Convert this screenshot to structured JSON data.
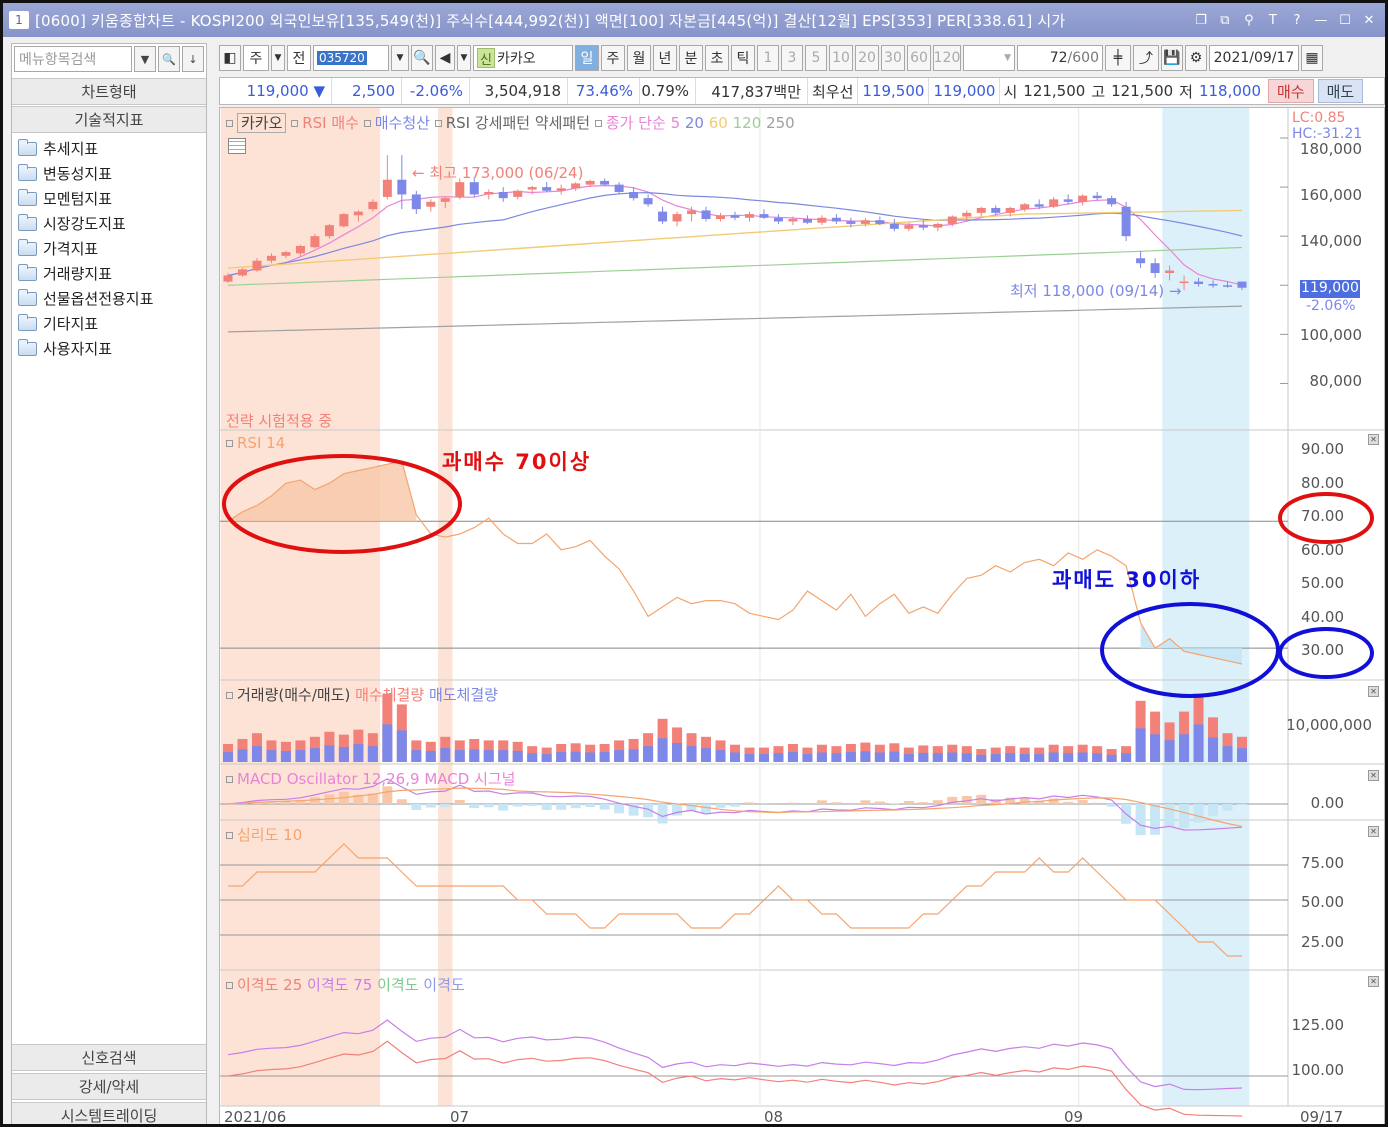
{
  "window": {
    "number": "1",
    "title": "[0600] 키움종합차트 - KOSPI200 외국인보유[135,549(천)] 주식수[444,992(천)] 액면[100] 자본금[445(억)] 결산[12월] EPS[353] PER[338.61] 시가"
  },
  "sidebar": {
    "search_placeholder": "메뉴항목검색",
    "header_top": "차트형태",
    "header_indicators": "기술적지표",
    "items": [
      {
        "label": "추세지표"
      },
      {
        "label": "변동성지표"
      },
      {
        "label": "모멘텀지표"
      },
      {
        "label": "시장강도지표"
      },
      {
        "label": "가격지표"
      },
      {
        "label": "거래량지표"
      },
      {
        "label": "선물옵션전용지표"
      },
      {
        "label": "기타지표"
      },
      {
        "label": "사용자지표"
      }
    ],
    "footer": [
      "신호검색",
      "강세/약세",
      "시스템트레이딩"
    ]
  },
  "toolbar": {
    "period": "주",
    "prev": "전",
    "code": "035720",
    "new_badge": "신",
    "stock_name": "카카오",
    "intervals": [
      "일",
      "주",
      "월",
      "년",
      "분",
      "초",
      "틱"
    ],
    "active_interval": "일",
    "minutes": [
      "1",
      "3",
      "5",
      "10",
      "20",
      "30",
      "60",
      "120"
    ],
    "count": "72",
    "count_total": "/600",
    "date": "2021/09/17"
  },
  "quote": {
    "price": "119,000",
    "change": "2,500",
    "change_pct": "-2.06%",
    "volume": "3,504,918",
    "vol_ratio": "73.46%",
    "turnover": "0.79%",
    "amount": "417,837백만",
    "best_label": "최우선",
    "best_ask": "119,500",
    "best_bid": "119,000",
    "open_label": "시",
    "open": "121,500",
    "high_label": "고",
    "high": "121,500",
    "low_label": "저",
    "low": "118,000",
    "buy": "매수",
    "sell": "매도"
  },
  "price_pane": {
    "legend_name": "카카오",
    "legend_items": [
      "RSI 매수",
      "매수청산",
      "RSI 강세패턴",
      "약세패턴"
    ],
    "ma_label": "종가 단순",
    "ma_periods": [
      "5",
      "20",
      "60",
      "120",
      "250"
    ],
    "lc": "LC:0.85",
    "hc": "HC:-31.21",
    "axis": [
      "180,000",
      "160,000",
      "140,000",
      "120,000",
      "100,000",
      "80,000"
    ],
    "current_price": "119,000",
    "current_pct": "-2.06%",
    "high_note": "최고 173,000 (06/24)",
    "low_note": "최저 118,000 (09/14)",
    "strategy_note": "전략 시험적용 중",
    "candles": [
      [
        121500,
        125000,
        121000,
        124000
      ],
      [
        124000,
        127000,
        123500,
        126500
      ],
      [
        126000,
        131000,
        125500,
        130000
      ],
      [
        130000,
        133000,
        129000,
        132000
      ],
      [
        132000,
        134000,
        131000,
        133500
      ],
      [
        133000,
        136500,
        132000,
        136000
      ],
      [
        135500,
        141000,
        135000,
        140000
      ],
      [
        140000,
        145000,
        139000,
        144500
      ],
      [
        144000,
        149500,
        143500,
        149000
      ],
      [
        148500,
        150500,
        146000,
        150000
      ],
      [
        151000,
        155000,
        150000,
        154000
      ],
      [
        156000,
        173000,
        155000,
        163000
      ],
      [
        163000,
        173000,
        151000,
        157000
      ],
      [
        157000,
        158500,
        149000,
        151000
      ],
      [
        152000,
        155000,
        150000,
        154000
      ],
      [
        154000,
        156000,
        151500,
        155500
      ],
      [
        156000,
        163500,
        155000,
        162000
      ],
      [
        162000,
        164000,
        156000,
        157000
      ],
      [
        157000,
        159000,
        155000,
        158000
      ],
      [
        158000,
        160000,
        154000,
        155500
      ],
      [
        156000,
        159000,
        155000,
        158500
      ],
      [
        159000,
        160500,
        157000,
        160000
      ],
      [
        160000,
        162000,
        158000,
        158500
      ],
      [
        158500,
        161000,
        157000,
        159500
      ],
      [
        159500,
        162000,
        158500,
        161500
      ],
      [
        161000,
        163000,
        160000,
        162500
      ],
      [
        162500,
        163500,
        160500,
        161000
      ],
      [
        161000,
        162000,
        157000,
        158000
      ],
      [
        158000,
        160000,
        154500,
        155500
      ],
      [
        155500,
        157000,
        152000,
        153000
      ],
      [
        150000,
        152000,
        145000,
        146000
      ],
      [
        146000,
        150000,
        144000,
        149000
      ],
      [
        149000,
        152000,
        146000,
        150500
      ],
      [
        150500,
        152000,
        146000,
        147000
      ],
      [
        147000,
        149500,
        146000,
        148500
      ],
      [
        148500,
        150000,
        146500,
        147500
      ],
      [
        147500,
        150000,
        146000,
        149000
      ],
      [
        149000,
        151000,
        147000,
        147500
      ],
      [
        147500,
        149000,
        145000,
        146000
      ],
      [
        146000,
        148000,
        144500,
        147000
      ],
      [
        147000,
        148500,
        145000,
        145500
      ],
      [
        145500,
        148500,
        144500,
        147500
      ],
      [
        147500,
        149000,
        145000,
        146000
      ],
      [
        146000,
        147500,
        143500,
        145000
      ],
      [
        145000,
        147500,
        144000,
        146500
      ],
      [
        146500,
        148000,
        144500,
        145000
      ],
      [
        145000,
        147000,
        142000,
        143000
      ],
      [
        143000,
        145500,
        142000,
        144500
      ],
      [
        144500,
        146500,
        142500,
        143500
      ],
      [
        143500,
        145500,
        142000,
        145000
      ],
      [
        145000,
        148500,
        144000,
        148000
      ],
      [
        148000,
        150500,
        146000,
        149500
      ],
      [
        149500,
        152000,
        148000,
        151500
      ],
      [
        151500,
        152500,
        148500,
        149500
      ],
      [
        149500,
        152000,
        148000,
        151500
      ],
      [
        151000,
        153500,
        150000,
        153000
      ],
      [
        153000,
        155000,
        151000,
        152000
      ],
      [
        152000,
        156000,
        151500,
        155000
      ],
      [
        155000,
        157000,
        153000,
        154000
      ],
      [
        154000,
        157000,
        152500,
        156500
      ],
      [
        156500,
        158000,
        154500,
        155500
      ],
      [
        155500,
        156500,
        152000,
        153000
      ],
      [
        152000,
        154000,
        138000,
        140000
      ],
      [
        131000,
        134000,
        127000,
        129000
      ],
      [
        129000,
        131000,
        123000,
        125000
      ],
      [
        125000,
        128000,
        122000,
        126000
      ],
      [
        121000,
        124000,
        118000,
        121500
      ],
      [
        121500,
        123000,
        119500,
        120500
      ],
      [
        120500,
        122000,
        119000,
        120000
      ],
      [
        120000,
        121500,
        119000,
        119500
      ],
      [
        121500,
        121500,
        118000,
        119000
      ]
    ]
  },
  "rsi_pane": {
    "legend": "RSI 14",
    "axis": [
      "90.00",
      "80.00",
      "70.00",
      "60.00",
      "50.00",
      "40.00",
      "30.00"
    ],
    "annotation_overbought": "과매수 70이상",
    "annotation_oversold": "과매도 30이하",
    "values": [
      70,
      73,
      75,
      78,
      82,
      83,
      80,
      82,
      85,
      86,
      87,
      88,
      89,
      72,
      66,
      65,
      66,
      68,
      71,
      66,
      63,
      63,
      66,
      61,
      62,
      64,
      59,
      55,
      48,
      40,
      43,
      46,
      44,
      45,
      45,
      44,
      41,
      40,
      39,
      42,
      48,
      45,
      42,
      47,
      40,
      44,
      47,
      41,
      43,
      41,
      47,
      52,
      53,
      56,
      54,
      57,
      58,
      56,
      60,
      58,
      61,
      59,
      56,
      38,
      30,
      33,
      29,
      28,
      27,
      26,
      25
    ]
  },
  "volume_pane": {
    "legend": "거래량(매수/매도)",
    "buy_legend": "매수체결량",
    "sell_legend": "매도체결량",
    "axis": [
      "10,000,000"
    ],
    "values": [
      0.25,
      0.32,
      0.4,
      0.3,
      0.28,
      0.3,
      0.35,
      0.42,
      0.38,
      0.45,
      0.4,
      0.95,
      0.8,
      0.3,
      0.28,
      0.35,
      0.3,
      0.32,
      0.3,
      0.3,
      0.28,
      0.22,
      0.2,
      0.25,
      0.26,
      0.24,
      0.25,
      0.3,
      0.32,
      0.4,
      0.6,
      0.48,
      0.4,
      0.35,
      0.3,
      0.24,
      0.2,
      0.2,
      0.22,
      0.25,
      0.2,
      0.24,
      0.22,
      0.25,
      0.27,
      0.24,
      0.26,
      0.2,
      0.23,
      0.22,
      0.24,
      0.22,
      0.18,
      0.2,
      0.22,
      0.2,
      0.2,
      0.24,
      0.22,
      0.24,
      0.22,
      0.18,
      0.22,
      0.85,
      0.7,
      0.55,
      0.7,
      0.95,
      0.62,
      0.4,
      0.35
    ]
  },
  "macd_pane": {
    "legend_osc": "MACD Oscillator 12,26,9",
    "legend_macd": "MACD",
    "legend_signal": "시그널",
    "axis": [
      "0.00"
    ]
  },
  "psy_pane": {
    "legend": "심리도 10",
    "axis": [
      "75.00",
      "50.00",
      "25.00"
    ],
    "values": [
      60,
      60,
      70,
      70,
      70,
      70,
      70,
      80,
      90,
      80,
      80,
      80,
      70,
      60,
      60,
      60,
      60,
      60,
      60,
      60,
      50,
      50,
      40,
      40,
      40,
      30,
      30,
      40,
      40,
      40,
      40,
      40,
      30,
      30,
      30,
      40,
      40,
      50,
      60,
      50,
      50,
      40,
      40,
      30,
      30,
      30,
      30,
      30,
      40,
      40,
      50,
      60,
      60,
      70,
      70,
      70,
      80,
      70,
      70,
      80,
      70,
      60,
      50,
      50,
      50,
      40,
      30,
      20,
      20,
      10,
      10
    ]
  },
  "disparity_pane": {
    "legend_items": [
      "이격도 25",
      "이격도 75",
      "이격도",
      "이격도"
    ],
    "axis": [
      "125.00",
      "100.00"
    ],
    "x_labels": [
      "2021/06",
      "07",
      "08",
      "09",
      "09/17"
    ]
  },
  "colors": {
    "up": "#f2817a",
    "down": "#7d88e8",
    "ma5": "#e884d6",
    "ma20": "#7d88e0",
    "ma60": "#f3cb74",
    "ma120": "#9ccf95",
    "ma250": "#a0a0a0",
    "rsi": "#f4a46e",
    "overbought_band": "#fde3d6",
    "oversold_band": "#dcf0fa",
    "annotation_red": "#e01010",
    "annotation_blue": "#1010d8"
  }
}
